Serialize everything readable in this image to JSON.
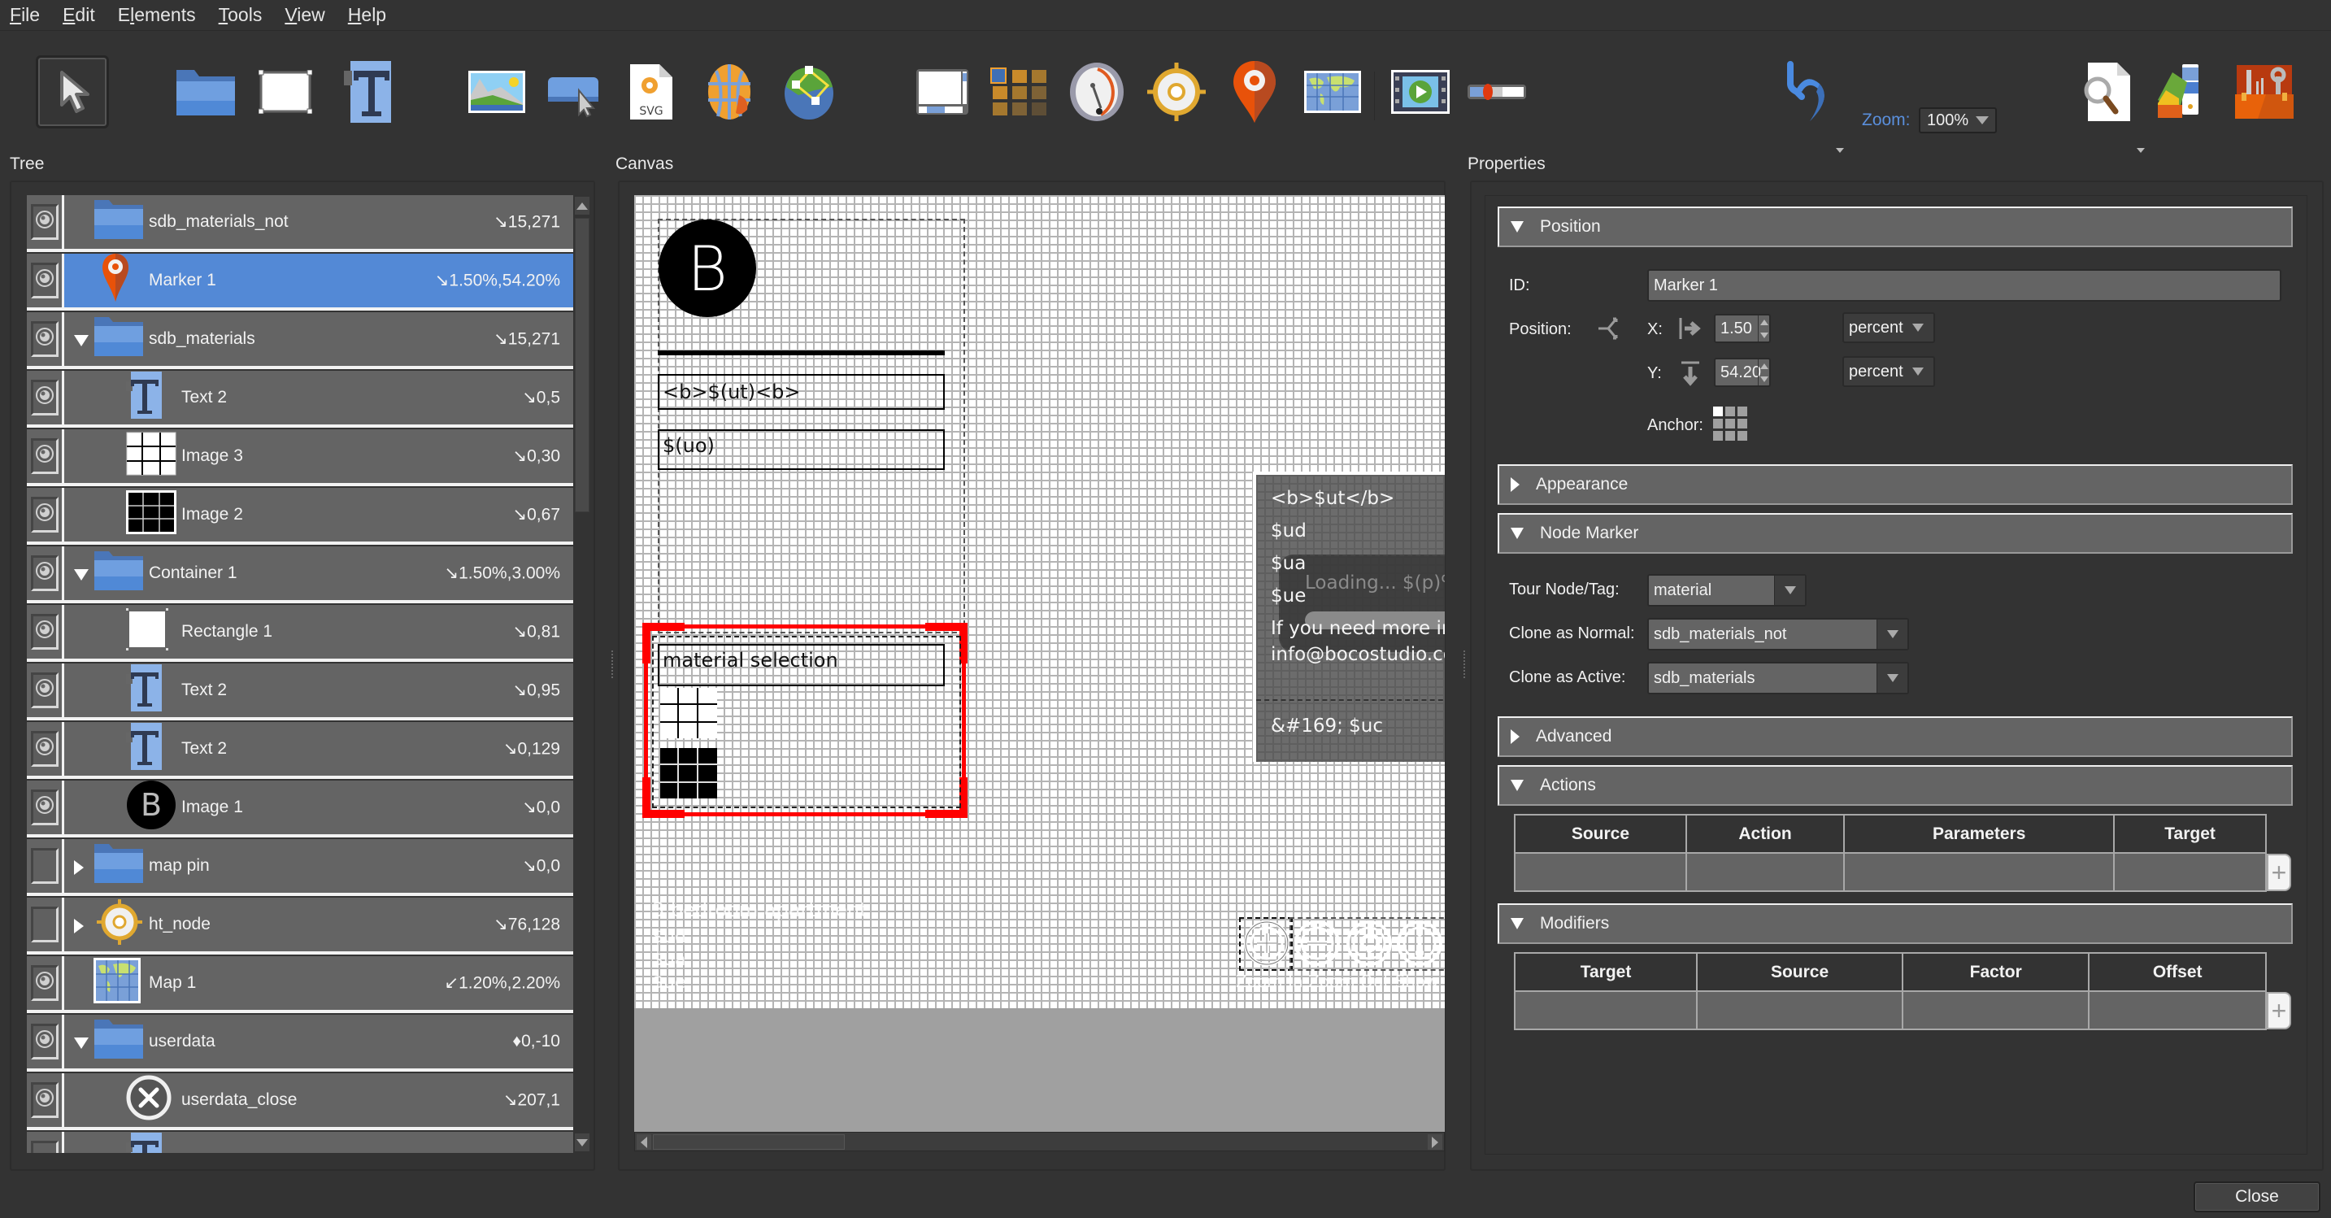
{
  "menu": [
    {
      "label": "File",
      "mnemonic_index": 0
    },
    {
      "label": "Edit",
      "mnemonic_index": 0
    },
    {
      "label": "Elements",
      "mnemonic_index": 1
    },
    {
      "label": "Tools",
      "mnemonic_index": 0
    },
    {
      "label": "View",
      "mnemonic_index": 0
    },
    {
      "label": "Help",
      "mnemonic_index": 0
    }
  ],
  "toolbar": {
    "tools": [
      {
        "name": "select-tool",
        "icon": "pointer-arrow-icon",
        "active": true
      },
      {
        "name": "add-container",
        "icon": "folder-icon"
      },
      {
        "name": "add-rectangle",
        "icon": "rectangle-icon"
      },
      {
        "name": "add-text",
        "icon": "text-t-icon"
      },
      {
        "name": "add-image",
        "icon": "image-landscape-icon"
      },
      {
        "name": "add-button",
        "icon": "button-cursor-icon"
      },
      {
        "name": "add-svg",
        "icon": "svg-file-icon",
        "text": "SVG"
      },
      {
        "name": "add-web",
        "icon": "globe-icon"
      },
      {
        "name": "add-tour-map",
        "icon": "network-globe-icon"
      },
      {
        "name": "add-scrollarea",
        "icon": "scroll-area-icon"
      },
      {
        "name": "add-cloner",
        "icon": "grid-cloner-icon"
      },
      {
        "name": "add-compass",
        "icon": "compass-dial-icon"
      },
      {
        "name": "add-node-marker",
        "icon": "crosshair-marker-icon"
      },
      {
        "name": "add-map-pin",
        "icon": "map-pin-icon"
      },
      {
        "name": "add-map",
        "icon": "world-map-icon"
      },
      {
        "name": "add-video",
        "icon": "video-player-icon"
      },
      {
        "name": "add-timeline",
        "icon": "timeline-slider-icon"
      },
      {
        "name": "undo",
        "icon": "undo-arrow-icon"
      },
      {
        "name": "preview",
        "icon": "document-search-icon"
      },
      {
        "name": "styles",
        "icon": "color-palette-icon"
      },
      {
        "name": "tools",
        "icon": "toolbox-icon"
      }
    ],
    "zoom_label": "Zoom:",
    "zoom_value": "100%"
  },
  "panels": {
    "tree_title": "Tree",
    "canvas_title": "Canvas",
    "properties_title": "Properties"
  },
  "tree": [
    {
      "label": "sdb_materials_not",
      "pos": "↘15,271",
      "icon": "folder-icon",
      "visible": true,
      "expander": "none",
      "level": 0
    },
    {
      "label": "Marker 1",
      "pos": "↘1.50%,54.20%",
      "icon": "map-pin-icon",
      "visible": true,
      "expander": "none",
      "level": 0,
      "selected": true
    },
    {
      "label": "sdb_materials",
      "pos": "↘15,271",
      "icon": "folder-icon",
      "visible": true,
      "expander": "open",
      "level": 0
    },
    {
      "label": "Text 2",
      "pos": "↘0,5",
      "icon": "text-t-icon",
      "visible": true,
      "expander": "none",
      "level": 1
    },
    {
      "label": "Image 3",
      "pos": "↘0,30",
      "icon": "white-grid-image-icon",
      "visible": true,
      "expander": "none",
      "level": 1
    },
    {
      "label": "Image 2",
      "pos": "↘0,67",
      "icon": "black-grid-image-icon",
      "visible": true,
      "expander": "none",
      "level": 1
    },
    {
      "label": "Container 1",
      "pos": "↘1.50%,3.00%",
      "icon": "folder-icon",
      "visible": true,
      "expander": "open",
      "level": 0
    },
    {
      "label": "Rectangle 1",
      "pos": "↘0,81",
      "icon": "rectangle-icon",
      "visible": true,
      "expander": "none",
      "level": 1
    },
    {
      "label": "Text 2",
      "pos": "↘0,95",
      "icon": "text-t-icon",
      "visible": true,
      "expander": "none",
      "level": 1
    },
    {
      "label": "Text 2",
      "pos": "↘0,129",
      "icon": "text-t-icon",
      "visible": true,
      "expander": "none",
      "level": 1
    },
    {
      "label": "Image 1",
      "pos": "↘0,0",
      "icon": "b-logo-icon",
      "visible": true,
      "expander": "none",
      "level": 1
    },
    {
      "label": "map pin",
      "pos": "↘0,0",
      "icon": "folder-icon",
      "visible": false,
      "expander": "closed",
      "level": 0
    },
    {
      "label": "ht_node",
      "pos": "↘76,128",
      "icon": "crosshair-marker-icon",
      "visible": false,
      "expander": "closed",
      "level": 0
    },
    {
      "label": "Map 1",
      "pos": "↙1.20%,2.20%",
      "icon": "world-map-icon",
      "visible": true,
      "expander": "none",
      "level": 0
    },
    {
      "label": "userdata",
      "pos": "♦0,-10",
      "icon": "folder-icon",
      "visible": true,
      "expander": "open",
      "level": 0
    },
    {
      "label": "userdata_close",
      "pos": "↘207,1",
      "icon": "close-circle-icon",
      "visible": true,
      "expander": "none",
      "level": 1
    },
    {
      "label": "",
      "pos": "",
      "icon": "text-t-icon",
      "visible": false,
      "expander": "none",
      "level": 1,
      "partial": true
    }
  ],
  "canvas": {
    "logo_letter": "B",
    "title_field": "<b>$(ut)<b>",
    "subtitle_field": "$(uo)",
    "material_field": "material selection",
    "overlay": {
      "lines": [
        "<b>$ut</b>",
        "$ud",
        "$ua",
        "$ue",
        "If you need more inf",
        "info@bocostudio.com"
      ],
      "footer": "&#169; $uc",
      "loading_text": "Loading... $(p)%"
    },
    "faint_lines": [
      "3 bedroom apartment",
      "$ud",
      "$ua",
      "$ue"
    ],
    "control_buttons": [
      "zoom-in",
      "zoom-out",
      "rotate",
      "info"
    ],
    "control_caption": "Zoom In Zoom Out Show User"
  },
  "properties": {
    "groups": {
      "position": "Position",
      "appearance": "Appearance",
      "node_marker": "Node Marker",
      "advanced": "Advanced",
      "actions": "Actions",
      "modifiers": "Modifiers"
    },
    "id_label": "ID:",
    "id_value": "Marker 1",
    "position_label": "Position:",
    "x_label": "X:",
    "x_value": "1.50",
    "x_unit": "percent",
    "y_label": "Y:",
    "y_value": "54.20",
    "y_unit": "percent",
    "anchor_label": "Anchor:",
    "anchor_selected": "top-left",
    "tour_node_label": "Tour Node/Tag:",
    "tour_node_value": "material",
    "clone_normal_label": "Clone as Normal:",
    "clone_normal_value": "sdb_materials_not",
    "clone_active_label": "Clone as Active:",
    "clone_active_value": "sdb_materials",
    "actions_columns": [
      "Source",
      "Action",
      "Parameters",
      "Target"
    ],
    "modifiers_columns": [
      "Target",
      "Source",
      "Factor",
      "Offset"
    ],
    "add_symbol": "+"
  },
  "footer": {
    "close_label": "Close"
  }
}
